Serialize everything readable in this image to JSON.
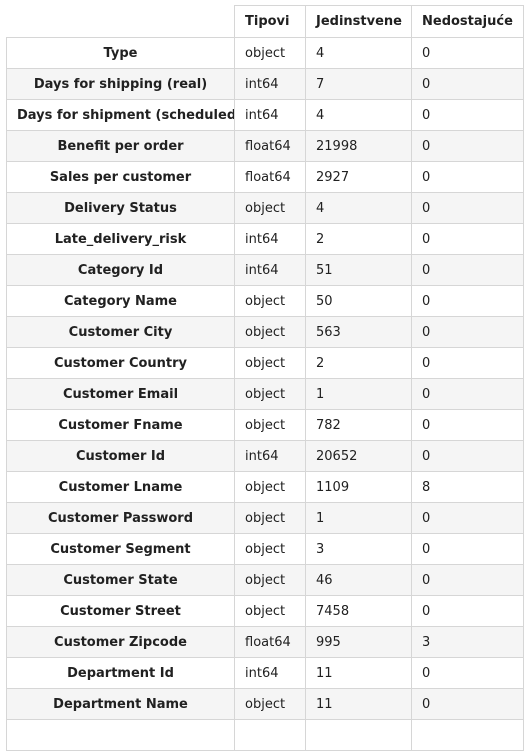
{
  "table": {
    "columns": [
      "",
      "Tipovi",
      "Jedinstvene",
      "Nedostajuće"
    ],
    "rows": [
      {
        "name": "Type",
        "type": "object",
        "unique": "4",
        "missing": "0"
      },
      {
        "name": "Days for shipping (real)",
        "type": "int64",
        "unique": "7",
        "missing": "0"
      },
      {
        "name": "Days for shipment (scheduled)",
        "type": "int64",
        "unique": "4",
        "missing": "0"
      },
      {
        "name": "Benefit per order",
        "type": "float64",
        "unique": "21998",
        "missing": "0"
      },
      {
        "name": "Sales per customer",
        "type": "float64",
        "unique": "2927",
        "missing": "0"
      },
      {
        "name": "Delivery Status",
        "type": "object",
        "unique": "4",
        "missing": "0"
      },
      {
        "name": "Late_delivery_risk",
        "type": "int64",
        "unique": "2",
        "missing": "0"
      },
      {
        "name": "Category Id",
        "type": "int64",
        "unique": "51",
        "missing": "0"
      },
      {
        "name": "Category Name",
        "type": "object",
        "unique": "50",
        "missing": "0"
      },
      {
        "name": "Customer City",
        "type": "object",
        "unique": "563",
        "missing": "0"
      },
      {
        "name": "Customer Country",
        "type": "object",
        "unique": "2",
        "missing": "0"
      },
      {
        "name": "Customer Email",
        "type": "object",
        "unique": "1",
        "missing": "0"
      },
      {
        "name": "Customer Fname",
        "type": "object",
        "unique": "782",
        "missing": "0"
      },
      {
        "name": "Customer Id",
        "type": "int64",
        "unique": "20652",
        "missing": "0"
      },
      {
        "name": "Customer Lname",
        "type": "object",
        "unique": "1109",
        "missing": "8"
      },
      {
        "name": "Customer Password",
        "type": "object",
        "unique": "1",
        "missing": "0"
      },
      {
        "name": "Customer Segment",
        "type": "object",
        "unique": "3",
        "missing": "0"
      },
      {
        "name": "Customer State",
        "type": "object",
        "unique": "46",
        "missing": "0"
      },
      {
        "name": "Customer Street",
        "type": "object",
        "unique": "7458",
        "missing": "0"
      },
      {
        "name": "Customer Zipcode",
        "type": "float64",
        "unique": "995",
        "missing": "3"
      },
      {
        "name": "Department Id",
        "type": "int64",
        "unique": "11",
        "missing": "0"
      },
      {
        "name": "Department Name",
        "type": "object",
        "unique": "11",
        "missing": "0"
      },
      {
        "name": "",
        "type": "",
        "unique": "",
        "missing": ""
      }
    ]
  }
}
